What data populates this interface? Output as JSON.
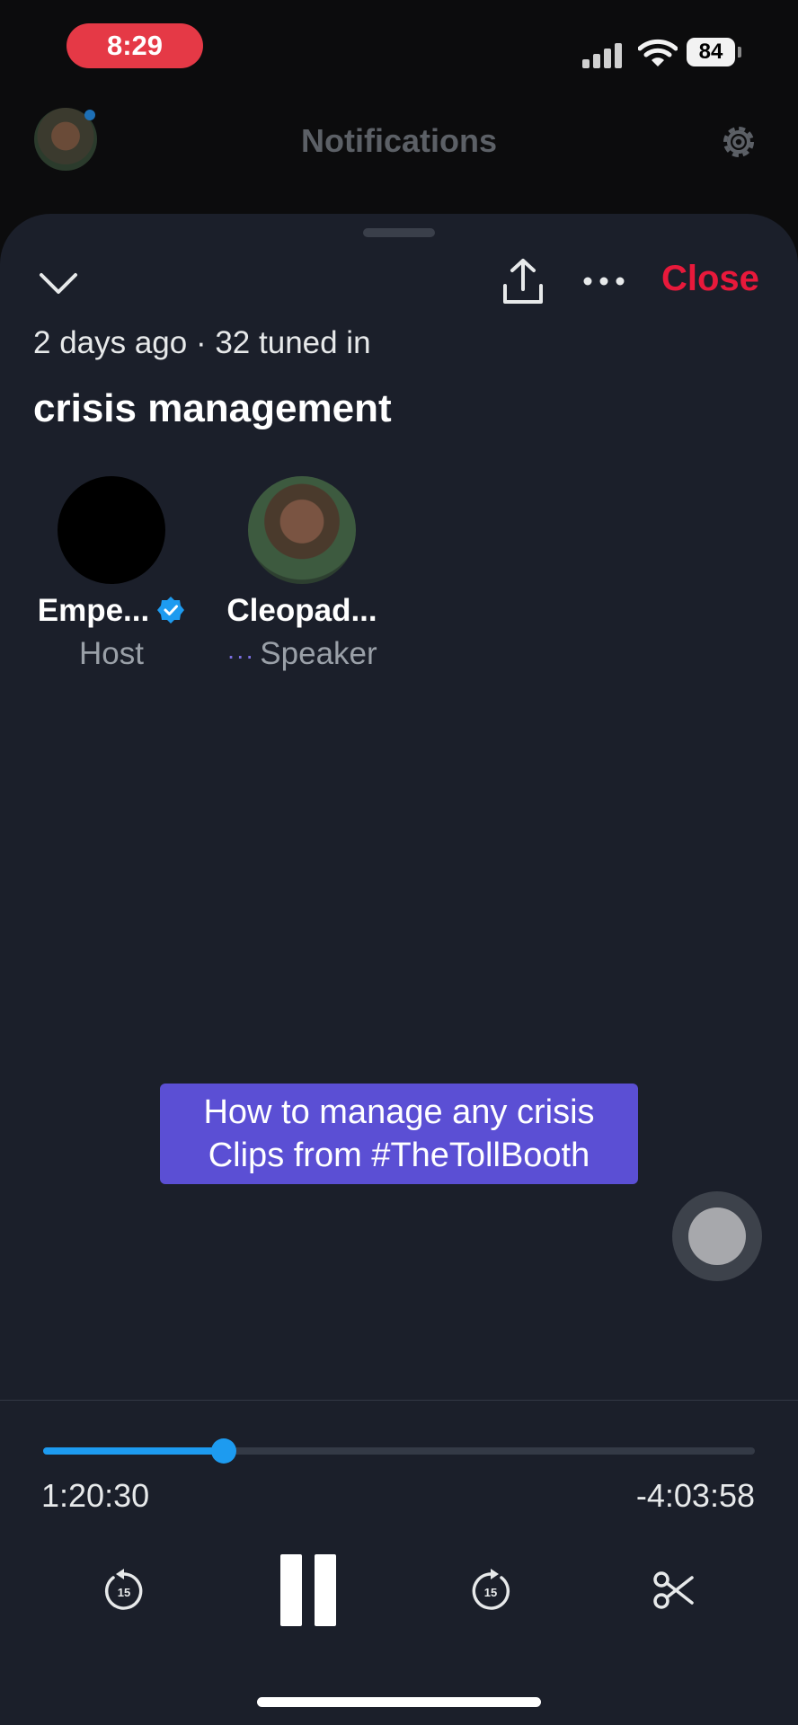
{
  "status_bar": {
    "time": "8:29",
    "battery": "84"
  },
  "background": {
    "title": "Notifications"
  },
  "sheet": {
    "close_label": "Close",
    "meta": "2 days ago · 32 tuned in",
    "title": "crisis management",
    "participants": [
      {
        "name": "Empe...",
        "role": "Host",
        "verified": true
      },
      {
        "name": "Cleopad...",
        "role": "Speaker",
        "speaking": true
      }
    ],
    "caption": {
      "line1": "How to manage any crisis",
      "line2": "Clips from #TheTollBooth"
    }
  },
  "player": {
    "elapsed": "1:20:30",
    "remaining": "-4:03:58",
    "progress": 0.2538,
    "accent_color": "#1d9bf0",
    "skip_back_seconds": "15",
    "skip_forward_seconds": "15"
  },
  "colors": {
    "close": "#e8193b",
    "caption_bg": "#5b4fd4",
    "sheet_bg": "#1b1f2a"
  },
  "icons": [
    "chevron-down-icon",
    "share-icon",
    "more-icon",
    "verified-icon",
    "skip-back-15-icon",
    "pause-icon",
    "skip-forward-15-icon",
    "scissors-icon",
    "gear-icon",
    "wifi-icon",
    "signal-icon",
    "battery-icon"
  ]
}
